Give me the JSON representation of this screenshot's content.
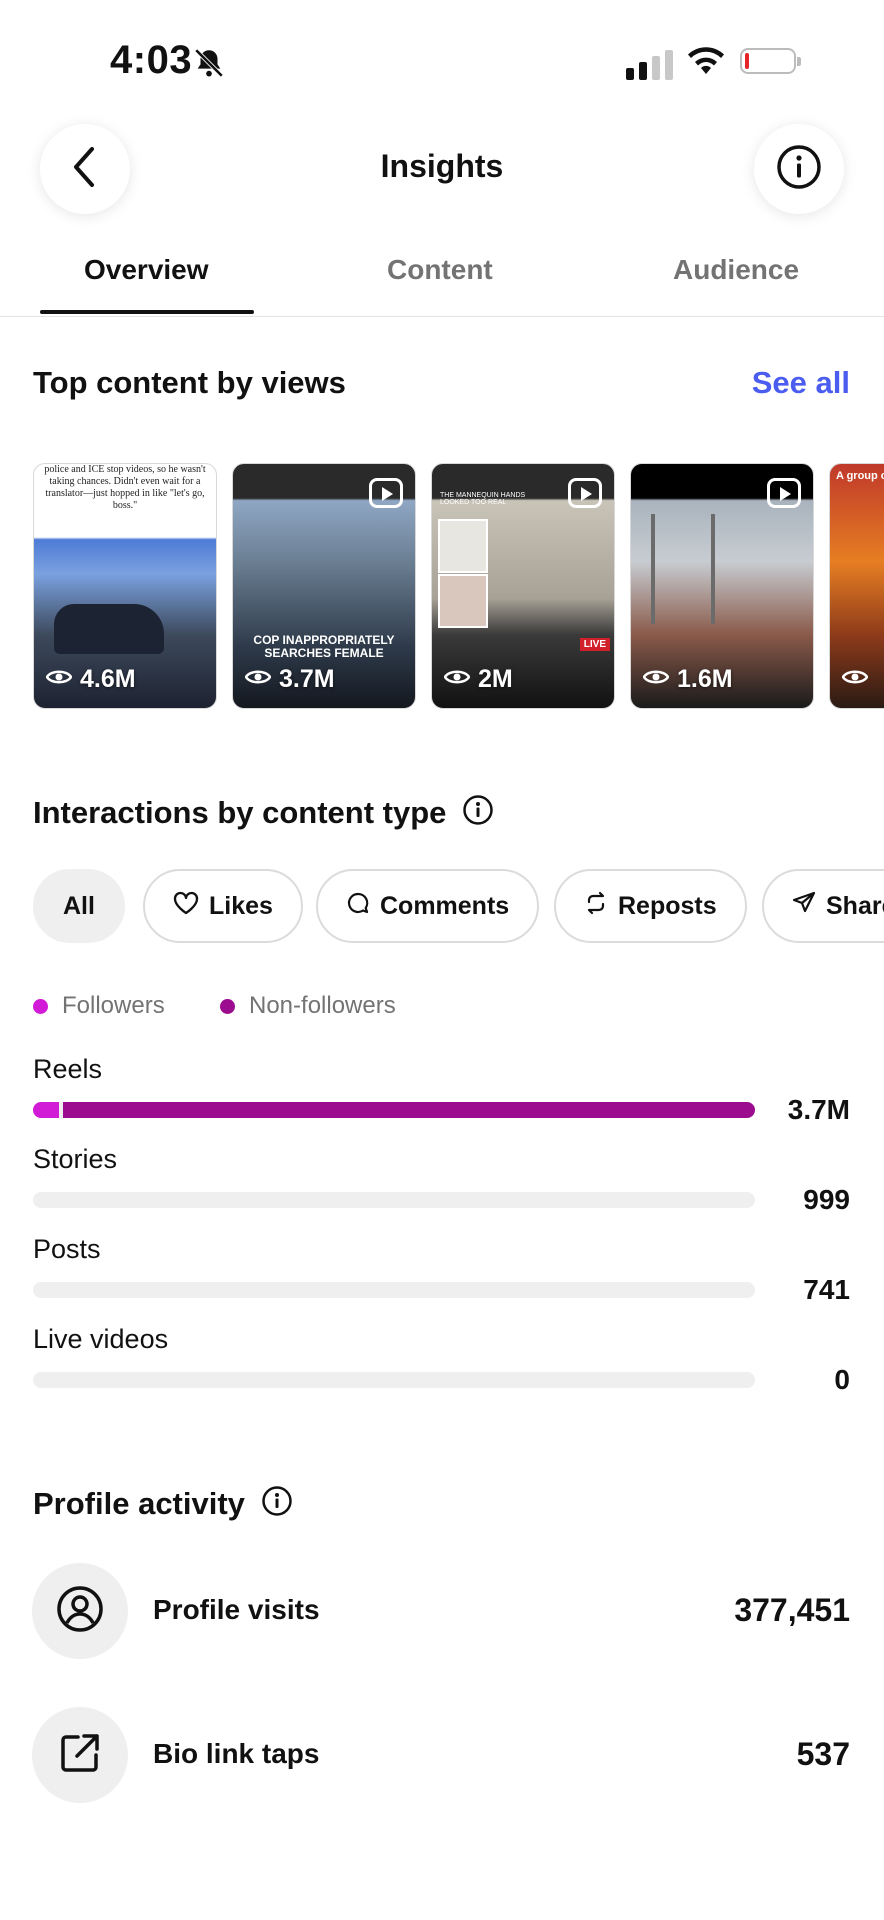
{
  "status_bar": {
    "time": "4:03"
  },
  "header": {
    "title": "Insights"
  },
  "tabs": [
    {
      "label": "Overview",
      "active": true
    },
    {
      "label": "Content",
      "active": false
    },
    {
      "label": "Audience",
      "active": false
    }
  ],
  "top_content": {
    "title": "Top content by views",
    "see_all": "See all",
    "items": [
      {
        "views": "4.6M",
        "caption": "police and ICE stop videos, so he wasn't taking chances. Didn't even wait for a translator—just hopped in like \"let's go, boss.\""
      },
      {
        "views": "3.7M",
        "caption": "COP INAPPROPRIATELY SEARCHES FEMALE"
      },
      {
        "views": "2M",
        "caption": "THE MANNEQUIN HANDS LOOKED TOO REAL",
        "badge": "LIVE"
      },
      {
        "views": "1.6M",
        "caption": ""
      },
      {
        "views": "",
        "caption": "A group of ... bucket of co... who"
      }
    ]
  },
  "interactions": {
    "title": "Interactions by content type",
    "chips": [
      {
        "label": "All",
        "icon": "",
        "active": true
      },
      {
        "label": "Likes",
        "icon": "heart-icon",
        "active": false
      },
      {
        "label": "Comments",
        "icon": "comment-icon",
        "active": false
      },
      {
        "label": "Reposts",
        "icon": "repost-icon",
        "active": false
      },
      {
        "label": "Shares",
        "icon": "share-icon",
        "active": false
      }
    ],
    "legend": [
      {
        "label": "Followers",
        "color": "#d11bd6"
      },
      {
        "label": "Non-followers",
        "color": "#9b0c8f"
      }
    ],
    "bars": [
      {
        "label": "Reels",
        "value": "3.7M",
        "followers_fraction": 0.036,
        "nonfollowers_fraction": 0.964
      },
      {
        "label": "Stories",
        "value": "999",
        "followers_fraction": 0,
        "nonfollowers_fraction": 0
      },
      {
        "label": "Posts",
        "value": "741",
        "followers_fraction": 0,
        "nonfollowers_fraction": 0
      },
      {
        "label": "Live videos",
        "value": "0",
        "followers_fraction": 0,
        "nonfollowers_fraction": 0
      }
    ]
  },
  "profile_activity": {
    "title": "Profile activity",
    "items": [
      {
        "label": "Profile visits",
        "value": "377,451",
        "icon": "user-circle-icon"
      },
      {
        "label": "Bio link taps",
        "value": "537",
        "icon": "external-link-icon"
      }
    ]
  },
  "colors": {
    "accent": "#4a5df0",
    "followers": "#d11bd6",
    "non_followers": "#9b0c8f"
  }
}
